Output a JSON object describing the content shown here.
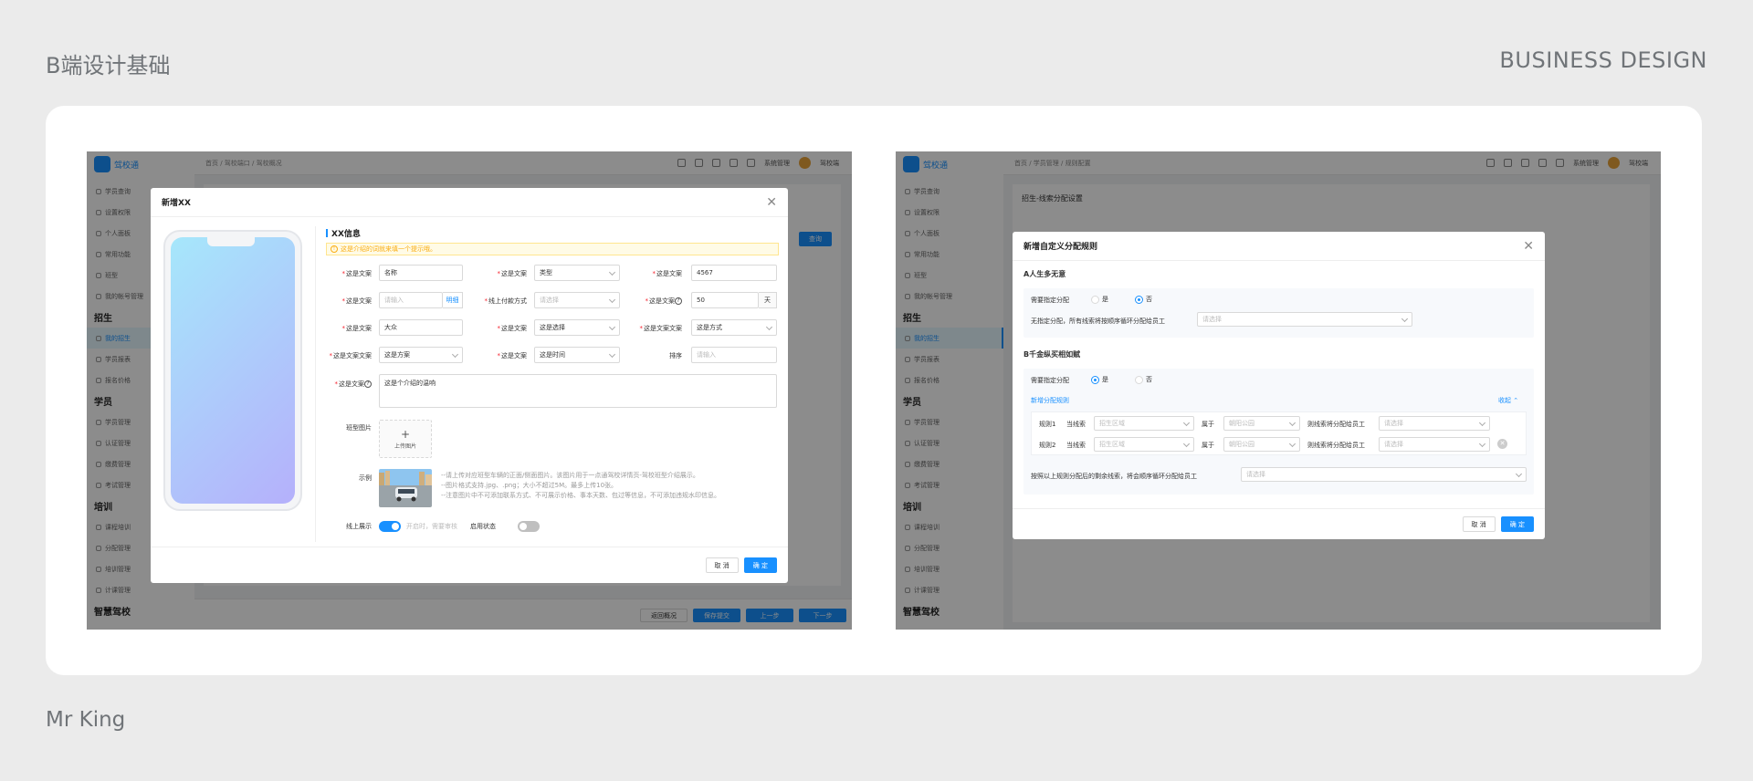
{
  "page": {
    "title": "B端设计基础",
    "tag": "BUSINESS DESIGN",
    "author": "Mr King"
  },
  "shot1": {
    "modal_title": "新增XX",
    "section_title": "XX信息",
    "alert": "这是介绍的词就来填一个提示哦。",
    "row1": {
      "l1": "这是文案",
      "v1": "名称",
      "l2": "这是文案",
      "v2": "类型",
      "l3": "这是文案",
      "v3": "4567"
    },
    "row2": {
      "l1": "这是文案",
      "ph1": "请输入",
      "addon1": "明细",
      "l2": "线上付款方式",
      "ph2": "请选择",
      "l3": "这是文案",
      "v3": "50",
      "addon3": "天"
    },
    "row3": {
      "l1": "这是文案",
      "v1": "大众",
      "l2": "这是文案",
      "v2": "这是选择",
      "l3": "这是文案文案",
      "v3": "这是方式"
    },
    "row4": {
      "l1": "这是文案文案",
      "v1": "这是方案",
      "l2": "这是文案",
      "v2": "这是时间",
      "l3": "排序",
      "ph3": "请输入"
    },
    "textarea_label": "这是文案",
    "textarea_value": "这是个介绍的温响",
    "upload_label": "班型图片",
    "upload_text": "上传图片",
    "example_label": "示例",
    "notes": [
      "--请上传对应班型车辆的正面/侧面图片。该图片用于一点通驾校详情页-驾校班型介绍展示。",
      "--图片格式支持.jpg、.png；大小不超过5M。最多上传10张。",
      "--注意图片中不可添加联系方式、不可展示价格、事本天数、包过等信息，不可添加违规水印信息。"
    ],
    "online_label": "线上展示",
    "online_hint": "开启时，需要审核",
    "enable_label": "启用状态",
    "cancel": "取 消",
    "ok": "确 定",
    "bg": {
      "app_name": "驾校通",
      "crumb": "首页 / 驾校端口 / 驾校概况",
      "user": "驾校端",
      "admin": "系统管理",
      "menu": [
        "学员查询",
        "设置权限",
        "个人面板",
        "常用功能",
        "班型",
        "我的帐号管理"
      ],
      "group1": "招生",
      "menu2": [
        "我的招生",
        "学员报表",
        "报名价格"
      ],
      "group2": "学员",
      "menu3": [
        "学员管理",
        "认证管理",
        "缴费管理",
        "考试管理"
      ],
      "group3": "培训",
      "menu4": [
        "课程培训",
        "分配管理",
        "培训管理",
        "计课管理"
      ],
      "group4": "智慧驾校",
      "footer_buttons": [
        "返回概况",
        "保存提交",
        "上一步",
        "下一步"
      ],
      "top_button": "查询"
    }
  },
  "shot2": {
    "modal_title": "新增自定义分配规则",
    "section_a": "A人生多无意",
    "need_assign_label": "需要指定分配",
    "yes": "是",
    "no": "否",
    "no_assign_text": "无指定分配，所有线索将按顺序循环分配给员工",
    "select_ph": "请选择",
    "section_b": "B千金纵买相如赋",
    "add_rule": "新增分配规则",
    "collapse": "收起",
    "rules": [
      {
        "name": "规则1",
        "clue_label": "当线索",
        "clue_ph": "招生区域",
        "belong_label": "属于",
        "belong_ph": "朝阳公园",
        "assign_label": "则线索将分配给员工",
        "assign_ph": "请选择"
      },
      {
        "name": "规则2",
        "clue_label": "当线索",
        "clue_ph": "招生区域",
        "belong_label": "属于",
        "belong_ph": "朝阳公园",
        "assign_label": "则线索将分配给员工",
        "assign_ph": "请选择"
      }
    ],
    "remaining_text": "按照以上规则分配后的剩余线索，将会顺序循环分配给员工",
    "cancel": "取 消",
    "ok": "确 定",
    "bg": {
      "app_name": "驾校通",
      "crumb": "首页 / 学员管理 / 规则配置",
      "page_heading": "招生-线索分配设置",
      "user": "驾校端"
    }
  },
  "colors": {
    "primary": "#1890ff",
    "background": "#ebebeb",
    "phone_gradient_start": "#a6e7fb",
    "phone_gradient_end": "#b5b0fb"
  }
}
